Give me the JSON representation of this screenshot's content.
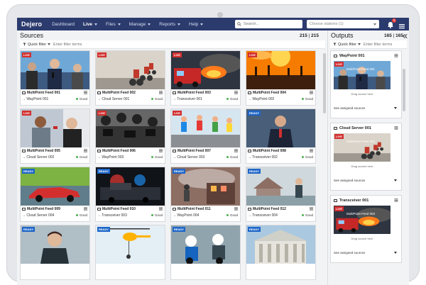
{
  "app": {
    "brand": "Dejero"
  },
  "nav": [
    {
      "label": "Dashboard",
      "active": false,
      "caret": false
    },
    {
      "label": "Live",
      "active": true,
      "caret": true
    },
    {
      "label": "Files",
      "active": false,
      "caret": true
    },
    {
      "label": "Manage",
      "active": false,
      "caret": true
    },
    {
      "label": "Reports",
      "active": false,
      "caret": true
    },
    {
      "label": "Help",
      "active": false,
      "caret": true
    }
  ],
  "search": {
    "placeholder": "Search..."
  },
  "station_chooser": {
    "label": "Choose stations (1)"
  },
  "notifications": {
    "count": "5"
  },
  "sources": {
    "title": "Sources",
    "count_shown": "215",
    "count_sep": " | ",
    "count_total": "215",
    "quick_filter": "Quick filter",
    "filter_placeholder": "Enter filter terms",
    "cards": [
      {
        "tag": "LIVE",
        "name": "MultiPoint Feed 001",
        "dest": "→ WayPoint 001",
        "status": "Good",
        "scene": "press"
      },
      {
        "tag": "LIVE",
        "name": "MultiPoint Feed 002",
        "dest": "→ Cloud Server 001",
        "status": "Good",
        "scene": "cycling"
      },
      {
        "tag": "LIVE",
        "name": "MultiPoint Feed 003",
        "dest": "→ Transceiver 001",
        "status": "Good",
        "scene": "fire"
      },
      {
        "tag": "LIVE",
        "name": "MultiPoint Feed 004",
        "dest": "→ WayPoint 002",
        "status": "Good",
        "scene": "concert"
      },
      {
        "tag": "LIVE",
        "name": "MultiPoint Feed 005",
        "dest": "→ Cloud Server 002",
        "status": "Good",
        "scene": "interview"
      },
      {
        "tag": "LIVE",
        "name": "MultiPoint Feed 006",
        "dest": "→ WayPoint 003",
        "status": "Good",
        "scene": "media"
      },
      {
        "tag": "LIVE",
        "name": "MultiPoint Feed 007",
        "dest": "→ Cloud Server 003",
        "status": "Good",
        "scene": "runners"
      },
      {
        "tag": "READY",
        "name": "MultiPoint Feed 008",
        "dest": "→ Transceiver 002",
        "status": "Good",
        "scene": "anchor"
      },
      {
        "tag": "READY",
        "name": "MultiPoint Feed 009",
        "dest": "→ Cloud Server 004",
        "status": "Good",
        "scene": "racecar"
      },
      {
        "tag": "READY",
        "name": "MultiPoint Feed 010",
        "dest": "→ Transceiver 003",
        "status": "Good",
        "scene": "police"
      },
      {
        "tag": "READY",
        "name": "MultiPoint Feed 011",
        "dest": "→ WayPoint 004",
        "status": "Good",
        "scene": "firefighters"
      },
      {
        "tag": "READY",
        "name": "MultiPoint Feed 012",
        "dest": "→ Transceiver 004",
        "status": "Good",
        "scene": "flood"
      },
      {
        "tag": "READY",
        "name": "",
        "dest": "",
        "status": "",
        "scene": "man"
      },
      {
        "tag": "READY",
        "name": "",
        "dest": "",
        "status": "",
        "scene": "helicopter"
      },
      {
        "tag": "READY",
        "name": "",
        "dest": "",
        "status": "",
        "scene": "bikes"
      },
      {
        "tag": "READY",
        "name": "",
        "dest": "",
        "status": "",
        "scene": "building"
      }
    ]
  },
  "outputs": {
    "title": "Outputs",
    "count_shown": "165",
    "count_sep": " | ",
    "count_total": "165",
    "quick_filter": "Quick filter",
    "filter_placeholder": "Enter filter terms",
    "cards": [
      {
        "name": "WayPoint 001",
        "tag": "LIVE",
        "feed": "MultiPoint Feed 001",
        "drag": "Drag source here",
        "assigned": "See assigned sources",
        "scene": "press"
      },
      {
        "name": "Cloud Server 001",
        "tag": "LIVE",
        "feed": "MultiPoint Feed 002",
        "drag": "Drag source here",
        "assigned": "See assigned sources",
        "scene": "cycling"
      },
      {
        "name": "Transceiver 001",
        "tag": "LIVE",
        "feed": "MultiPoint Feed 003",
        "drag": "Drag source here",
        "assigned": "See assigned sources",
        "scene": "fire"
      }
    ]
  },
  "colors": {
    "topbar": "#2c3b6e",
    "live": "#d32f2f",
    "ready": "#1e66c8",
    "good": "#4caf50"
  }
}
